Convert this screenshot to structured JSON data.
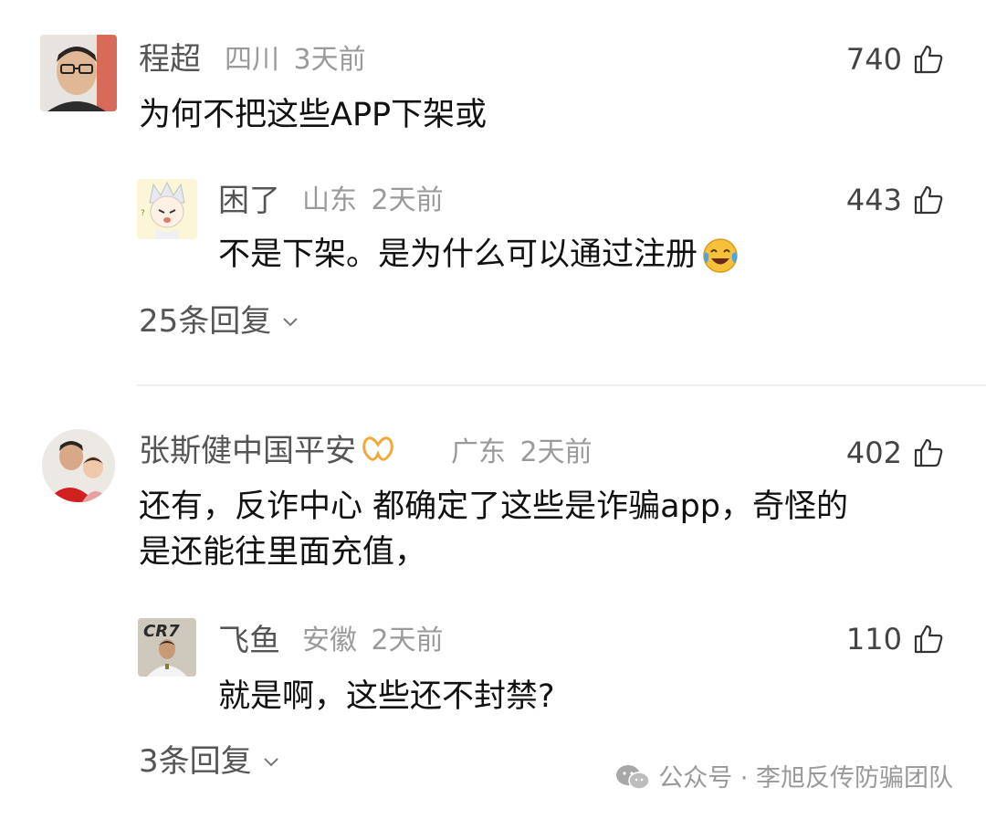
{
  "comments": [
    {
      "name": "程超",
      "location": "四川",
      "time": "3天前",
      "likes": "740",
      "text": "为何不把这些APP下架或",
      "reply": {
        "name": "困了",
        "location": "山东",
        "time": "2天前",
        "likes": "443",
        "text": "不是下架。是为什么可以通过注册"
      },
      "replies_label": "25条回复"
    },
    {
      "name": "张斯健中国平安",
      "location": "广东",
      "time": "2天前",
      "likes": "402",
      "text_line1": "还有，反诈中心 都确定了这些是诈骗app，奇怪的",
      "text_line2": "是还能往里面充值，",
      "reply": {
        "name": "飞鱼",
        "location": "安徽",
        "time": "2天前",
        "likes": "110",
        "text": "就是啊，这些还不封禁?",
        "avatar_text": "CR7"
      },
      "replies_label": "3条回复"
    }
  ],
  "watermark": {
    "text": "公众号 · 李旭反传防骗团队"
  },
  "colors": {
    "name": "#555555",
    "meta": "#9a9a9a",
    "body": "#111111",
    "divider": "#efefef",
    "badge": "#f0a93a"
  }
}
